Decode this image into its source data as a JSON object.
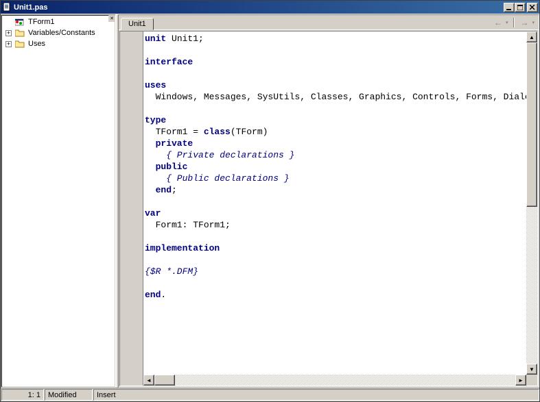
{
  "title": "Unit1.pas",
  "tree": {
    "items": [
      {
        "label": "TForm1",
        "icon": "form",
        "expandable": false
      },
      {
        "label": "Variables/Constants",
        "icon": "folder",
        "expandable": true
      },
      {
        "label": "Uses",
        "icon": "folder",
        "expandable": true
      }
    ]
  },
  "tab_label": "Unit1",
  "status": {
    "position": "1: 1",
    "modified": "Modified",
    "insert_mode": "Insert"
  },
  "code": {
    "l1a": "unit",
    "l1b": " Unit1;",
    "l3": "interface",
    "l5": "uses",
    "l6": "  Windows, Messages, SysUtils, Classes, Graphics, Controls, Forms, Dialogs",
    "l8": "type",
    "l9a": "  TForm1 = ",
    "l9b": "class",
    "l9c": "(TForm)",
    "l10": "  private",
    "l11": "    { Private declarations }",
    "l12": "  public",
    "l13": "    { Public declarations }",
    "l14a": "  ",
    "l14b": "end",
    "l14c": ";",
    "l16": "var",
    "l17": "  Form1: TForm1;",
    "l19": "implementation",
    "l21": "{$R *.DFM}",
    "l23a": "end",
    "l23b": "."
  }
}
